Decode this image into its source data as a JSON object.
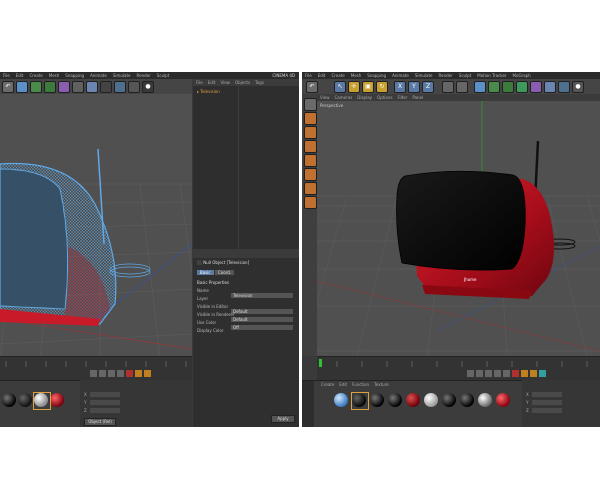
{
  "left_window": {
    "menu": [
      "File",
      "Edit",
      "Create",
      "Mesh",
      "Snapping",
      "Animate",
      "Simulate",
      "Render",
      "Sculpt",
      "Motion Tracker",
      "MoGraph",
      "Character",
      "Plugins",
      "Script",
      "Window",
      "Help"
    ],
    "layout_badge": "CINEMA 4D",
    "objects_panel": {
      "menu": [
        "File",
        "Edit",
        "View",
        "Objects",
        "Tags",
        "Bookmarks"
      ],
      "item": "Television"
    },
    "attributes": {
      "header": "Basic Properties",
      "tabs": [
        "Basic",
        "Coord."
      ],
      "rows": [
        {
          "label": "Name",
          "value": "Television"
        },
        {
          "label": "Layer",
          "value": ""
        },
        {
          "label": "Visible in Editor",
          "value": "Default"
        },
        {
          "label": "Visible in Renderer",
          "value": "Default"
        },
        {
          "label": "Use Color",
          "value": "Off"
        },
        {
          "label": "Display Color",
          "value": ""
        }
      ],
      "apply_label": "Apply"
    },
    "materials_menu": [
      "Create",
      "Edit",
      "Function",
      "Texture"
    ],
    "coord_button": "Object (Rel)",
    "size_button": "Size"
  },
  "right_window": {
    "menu": [
      "File",
      "Edit",
      "Create",
      "Mesh",
      "Snapping",
      "Animate",
      "Simulate",
      "Render",
      "Sculpt",
      "Motion Tracker",
      "MoGraph",
      "Character",
      "Plugins",
      "Script",
      "Window",
      "Help"
    ],
    "viewport_menu": [
      "View",
      "Cameras",
      "Display",
      "Options",
      "Filter",
      "Panel"
    ],
    "viewport_label": "Perspective",
    "tv_logo": "Jhome",
    "materials_menu": [
      "Create",
      "Edit",
      "Function",
      "Texture"
    ]
  },
  "colors": {
    "tv_red": "#b5101e",
    "tv_screen": "#050505",
    "wire_blue": "#5fa8e6",
    "wire_red": "#d02030",
    "ui_dark": "#3a3a3a",
    "viewport_bg": "#505050"
  },
  "icons": [
    "undo-icon",
    "redo-icon",
    "move-icon",
    "scale-icon",
    "rotate-icon",
    "cube-icon",
    "spline-icon",
    "nurbs-icon",
    "deformer-icon",
    "camera-icon",
    "light-icon",
    "render-icon"
  ]
}
